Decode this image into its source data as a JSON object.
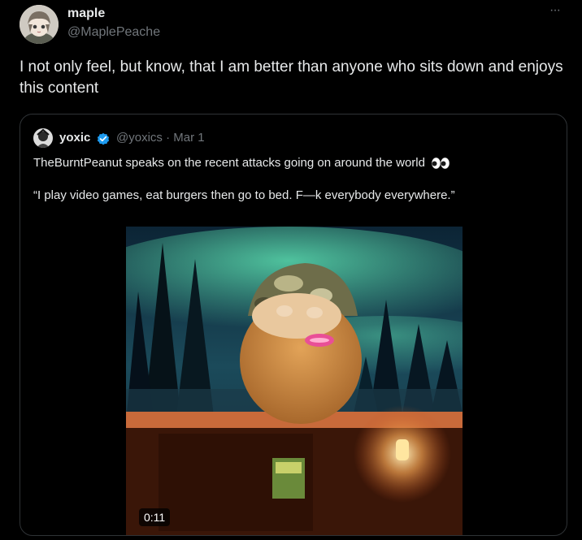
{
  "post": {
    "display_name": "maple",
    "handle": "@MaplePeache",
    "more_label": "···",
    "text": "I not only feel, but know, that I am better than anyone who sits down and enjoys this content"
  },
  "quoted_post": {
    "display_name": "yoxic",
    "handle": "@yoxics",
    "separator": "·",
    "date": "Mar 1",
    "text_line1": "TheBurntPeanut speaks on the recent attacks going on around the world",
    "text_line2": "“I play video games, eat burgers then go to bed. F—k everybody everywhere.”",
    "verified_icon": "verified-badge-icon",
    "eyes_icon": "eyes-emoji-icon"
  },
  "video": {
    "duration": "0:11"
  },
  "colors": {
    "background": "#000000",
    "text_primary": "#e7e9ea",
    "text_secondary": "#71767b",
    "border": "#2f3336",
    "verified": "#1d9bf0"
  }
}
